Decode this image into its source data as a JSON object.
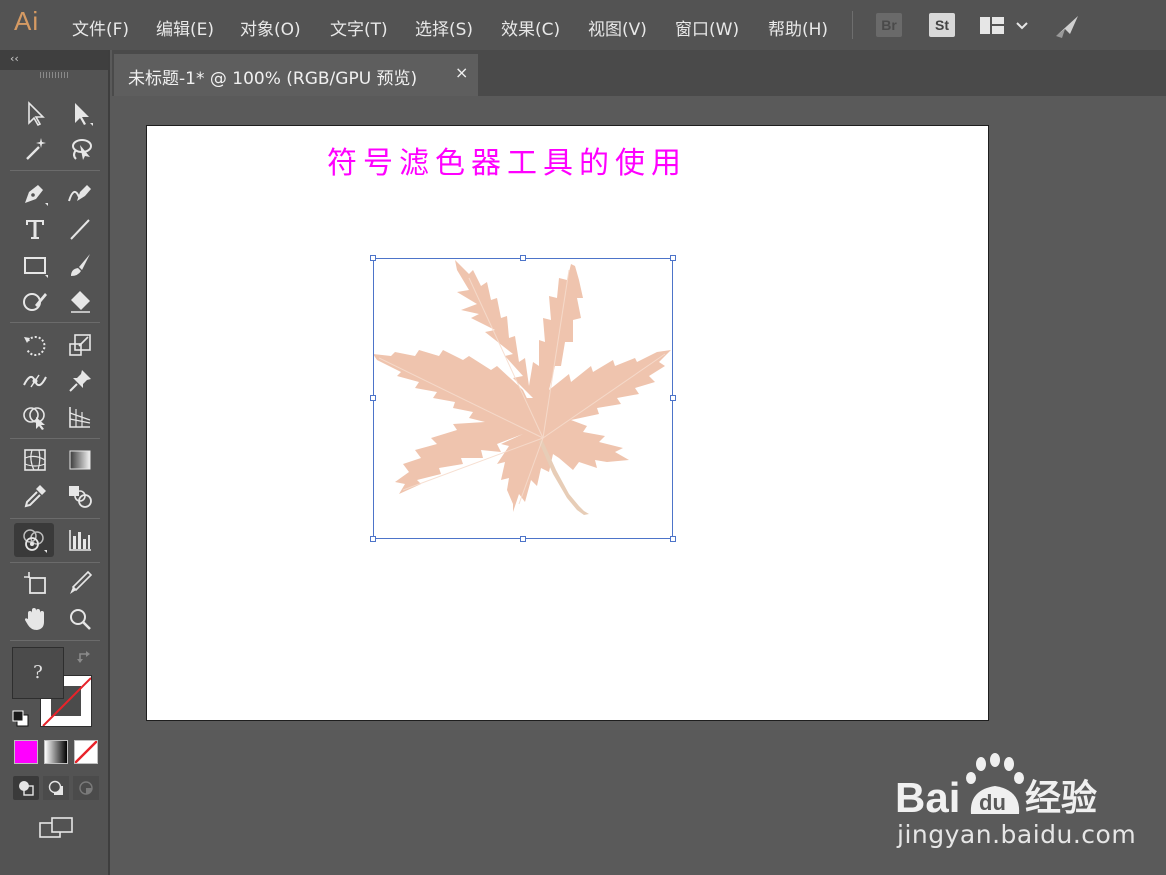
{
  "app": {
    "logo_text": "Ai",
    "menu": [
      "文件(F)",
      "编辑(E)",
      "对象(O)",
      "文字(T)",
      "选择(S)",
      "效果(C)",
      "视图(V)",
      "窗口(W)",
      "帮助(H)"
    ],
    "bridge_label": "Br",
    "stock_label": "St"
  },
  "tools_panel": {
    "collapse_glyph": "‹‹",
    "tools": [
      "selection",
      "direct-selection",
      "magic-wand",
      "lasso",
      "pen",
      "curvature",
      "type",
      "line-segment",
      "rectangle",
      "paintbrush",
      "shaper",
      "eraser",
      "rotate",
      "scale",
      "width",
      "puppet-warp",
      "shape-builder",
      "perspective-grid",
      "mesh",
      "gradient",
      "eyedropper",
      "blend",
      "symbol-sprayer",
      "column-graph",
      "artboard",
      "slice",
      "hand",
      "zoom"
    ],
    "active_tool": "symbol-sprayer",
    "fill_unknown_glyph": "?",
    "colors": {
      "fill_mode": "#ff00ff",
      "none_stroke": "#e8232a"
    }
  },
  "document": {
    "tab_title": "未标题-1* @ 100% (RGB/GPU 预览)",
    "close_glyph": "×"
  },
  "artboard": {
    "heading": "符号滤色器工具的使用",
    "heading_color": "#ff00ff",
    "leaf_color": "#efc4ae",
    "selection_color": "#4d74c9"
  },
  "watermark": {
    "brand": "Bai du 经验",
    "url": "jingyan.baidu.com"
  }
}
